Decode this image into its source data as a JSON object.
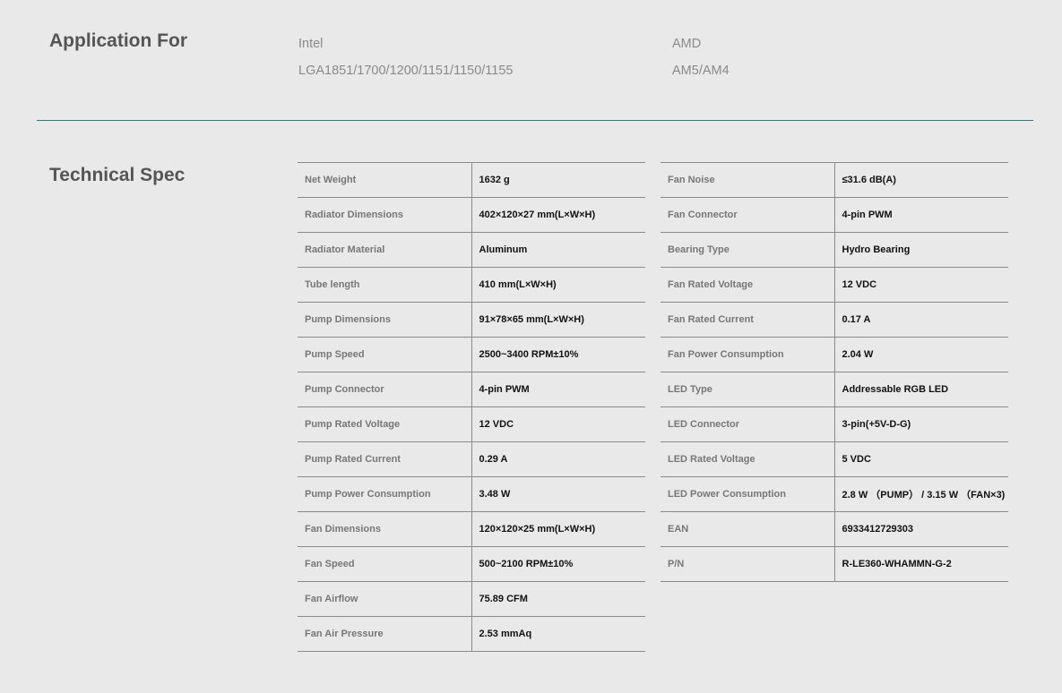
{
  "application": {
    "title": "Application For",
    "intel": {
      "name": "Intel",
      "sockets": "LGA1851/1700/1200/1151/1150/1155"
    },
    "amd": {
      "name": "AMD",
      "sockets": "AM5/AM4"
    }
  },
  "technical_spec": {
    "title": "Technical Spec",
    "left": [
      {
        "label": "Net Weight",
        "value": "1632 g"
      },
      {
        "label": "Radiator Dimensions",
        "value": "402×120×27 mm(L×W×H)"
      },
      {
        "label": "Radiator Material",
        "value": "Aluminum"
      },
      {
        "label": "Tube length",
        "value": "410 mm(L×W×H)"
      },
      {
        "label": "Pump Dimensions",
        "value": "91×78×65 mm(L×W×H)"
      },
      {
        "label": "Pump Speed",
        "value": "2500~3400 RPM±10%"
      },
      {
        "label": "Pump Connector",
        "value": "4-pin PWM"
      },
      {
        "label": "Pump Rated Voltage",
        "value": "12 VDC"
      },
      {
        "label": "Pump Rated Current",
        "value": "0.29 A"
      },
      {
        "label": "Pump Power Consumption",
        "value": "3.48 W"
      },
      {
        "label": "Fan Dimensions",
        "value": "120×120×25 mm(L×W×H)"
      },
      {
        "label": "Fan Speed",
        "value": "500~2100 RPM±10%"
      },
      {
        "label": "Fan Airflow",
        "value": "75.89 CFM"
      },
      {
        "label": "Fan Air Pressure",
        "value": "2.53 mmAq"
      }
    ],
    "right": [
      {
        "label": "Fan Noise",
        "value": "≤31.6 dB(A)"
      },
      {
        "label": "Fan Connector",
        "value": "4-pin PWM"
      },
      {
        "label": "Bearing Type",
        "value": "Hydro Bearing"
      },
      {
        "label": "Fan Rated Voltage",
        "value": "12 VDC"
      },
      {
        "label": "Fan Rated Current",
        "value": "0.17 A"
      },
      {
        "label": "Fan Power Consumption",
        "value": "2.04 W"
      },
      {
        "label": "LED Type",
        "value": "Addressable RGB LED"
      },
      {
        "label": "LED Connector",
        "value": "3-pin(+5V-D-G)"
      },
      {
        "label": "LED Rated Voltage",
        "value": "5 VDC"
      },
      {
        "label": "LED Power Consumption",
        "value": "2.8 W （PUMP） / 3.15 W （FAN×3)"
      },
      {
        "label": "EAN",
        "value": "6933412729303"
      },
      {
        "label": "P/N",
        "value": "R-LE360-WHAMMN-G-2"
      }
    ]
  }
}
